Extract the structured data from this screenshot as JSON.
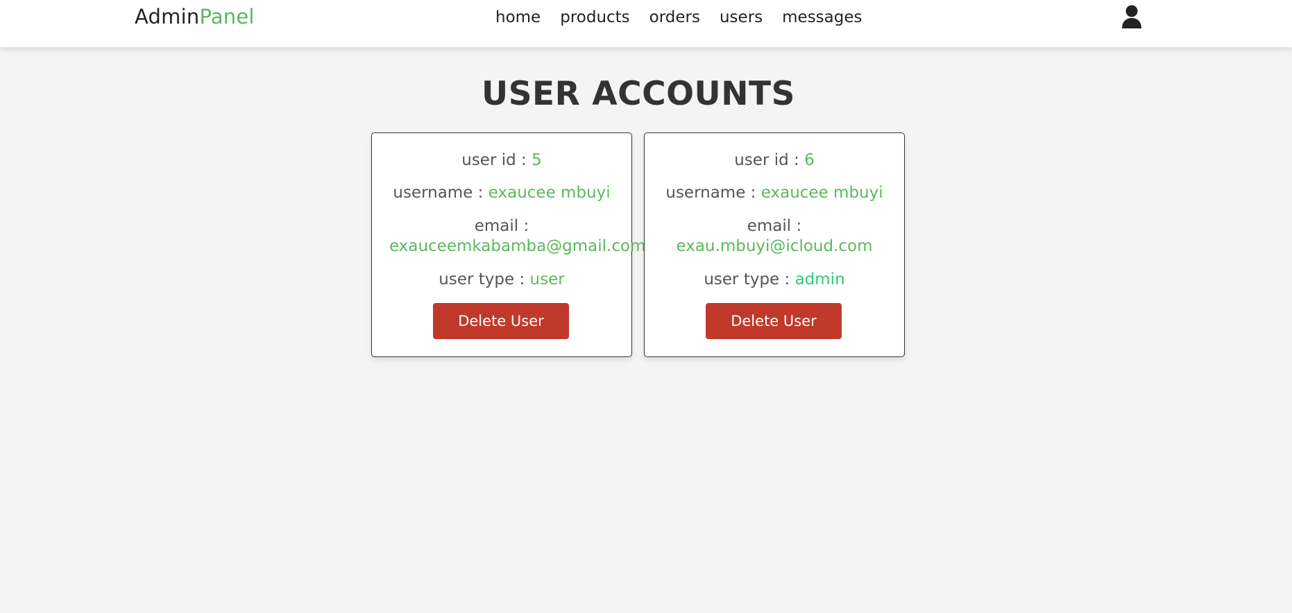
{
  "header": {
    "logo_main": "Admin",
    "logo_accent": "Panel",
    "nav": [
      "home",
      "products",
      "orders",
      "users",
      "messages"
    ],
    "user_icon": "user-icon"
  },
  "page": {
    "title": "USER ACCOUNTS"
  },
  "labels": {
    "user_id": "user id : ",
    "username": "username : ",
    "email": "email :",
    "user_type": "user type : "
  },
  "users": [
    {
      "id": "5",
      "username": "exaucee mbuyi",
      "email": "exauceemkabamba@gmail.com",
      "type": "user",
      "delete_label": "Delete User"
    },
    {
      "id": "6",
      "username": "exaucee mbuyi",
      "email": "exau.mbuyi@icloud.com",
      "type": "admin",
      "delete_label": "Delete User"
    }
  ],
  "colors": {
    "accent": "#5cb85c",
    "admin": "#2ecc71",
    "danger": "#c0392b",
    "text": "#333333",
    "background": "#f4f4f4"
  }
}
